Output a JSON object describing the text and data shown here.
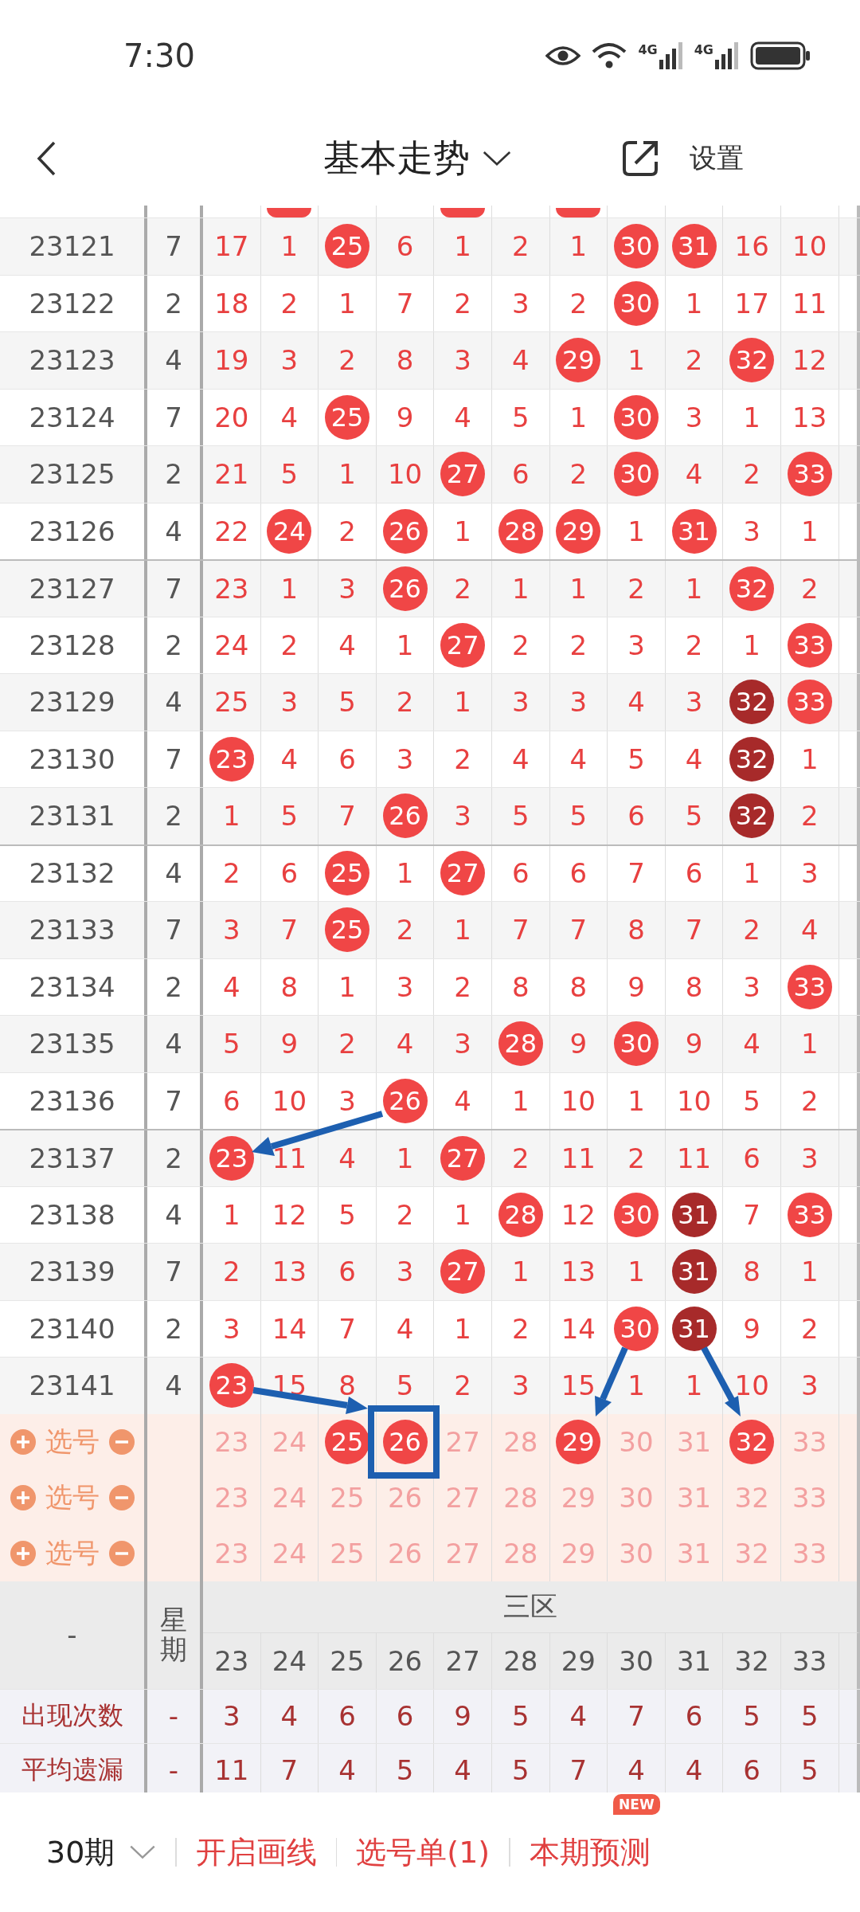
{
  "status_bar": {
    "time": "7:30",
    "network_labels": [
      "4G",
      "4G"
    ]
  },
  "header": {
    "title": "基本走势",
    "settings": "设置"
  },
  "cut_off_row": {
    "hits": [
      false,
      true,
      false,
      false,
      true,
      false,
      true,
      false,
      false,
      false,
      false
    ]
  },
  "rows": [
    {
      "period": "23121",
      "weekday": "7",
      "cells": [
        {
          "value": "17",
          "hit": false
        },
        {
          "value": "1",
          "hit": false
        },
        {
          "value": "25",
          "hit": true
        },
        {
          "value": "6",
          "hit": false
        },
        {
          "value": "1",
          "hit": false
        },
        {
          "value": "2",
          "hit": false
        },
        {
          "value": "1",
          "hit": false
        },
        {
          "value": "30",
          "hit": true
        },
        {
          "value": "31",
          "hit": true
        },
        {
          "value": "16",
          "hit": false
        },
        {
          "value": "10",
          "hit": false
        }
      ]
    },
    {
      "period": "23122",
      "weekday": "2",
      "cells": [
        {
          "value": "18",
          "hit": false
        },
        {
          "value": "2",
          "hit": false
        },
        {
          "value": "1",
          "hit": false
        },
        {
          "value": "7",
          "hit": false
        },
        {
          "value": "2",
          "hit": false
        },
        {
          "value": "3",
          "hit": false
        },
        {
          "value": "2",
          "hit": false
        },
        {
          "value": "30",
          "hit": true
        },
        {
          "value": "1",
          "hit": false
        },
        {
          "value": "17",
          "hit": false
        },
        {
          "value": "11",
          "hit": false
        }
      ]
    },
    {
      "period": "23123",
      "weekday": "4",
      "cells": [
        {
          "value": "19",
          "hit": false
        },
        {
          "value": "3",
          "hit": false
        },
        {
          "value": "2",
          "hit": false
        },
        {
          "value": "8",
          "hit": false
        },
        {
          "value": "3",
          "hit": false
        },
        {
          "value": "4",
          "hit": false
        },
        {
          "value": "29",
          "hit": true
        },
        {
          "value": "1",
          "hit": false
        },
        {
          "value": "2",
          "hit": false
        },
        {
          "value": "32",
          "hit": true
        },
        {
          "value": "12",
          "hit": false
        }
      ]
    },
    {
      "period": "23124",
      "weekday": "7",
      "cells": [
        {
          "value": "20",
          "hit": false
        },
        {
          "value": "4",
          "hit": false
        },
        {
          "value": "25",
          "hit": true
        },
        {
          "value": "9",
          "hit": false
        },
        {
          "value": "4",
          "hit": false
        },
        {
          "value": "5",
          "hit": false
        },
        {
          "value": "1",
          "hit": false
        },
        {
          "value": "30",
          "hit": true
        },
        {
          "value": "3",
          "hit": false
        },
        {
          "value": "1",
          "hit": false
        },
        {
          "value": "13",
          "hit": false
        }
      ]
    },
    {
      "period": "23125",
      "weekday": "2",
      "cells": [
        {
          "value": "21",
          "hit": false
        },
        {
          "value": "5",
          "hit": false
        },
        {
          "value": "1",
          "hit": false
        },
        {
          "value": "10",
          "hit": false
        },
        {
          "value": "27",
          "hit": true
        },
        {
          "value": "6",
          "hit": false
        },
        {
          "value": "2",
          "hit": false
        },
        {
          "value": "30",
          "hit": true
        },
        {
          "value": "4",
          "hit": false
        },
        {
          "value": "2",
          "hit": false
        },
        {
          "value": "33",
          "hit": true
        }
      ]
    },
    {
      "period": "23126",
      "weekday": "4",
      "cells": [
        {
          "value": "22",
          "hit": false
        },
        {
          "value": "24",
          "hit": true
        },
        {
          "value": "2",
          "hit": false
        },
        {
          "value": "26",
          "hit": true
        },
        {
          "value": "1",
          "hit": false
        },
        {
          "value": "28",
          "hit": true
        },
        {
          "value": "29",
          "hit": true
        },
        {
          "value": "1",
          "hit": false
        },
        {
          "value": "31",
          "hit": true
        },
        {
          "value": "3",
          "hit": false
        },
        {
          "value": "1",
          "hit": false
        }
      ]
    },
    {
      "period": "23127",
      "weekday": "7",
      "cells": [
        {
          "value": "23",
          "hit": false
        },
        {
          "value": "1",
          "hit": false
        },
        {
          "value": "3",
          "hit": false
        },
        {
          "value": "26",
          "hit": true
        },
        {
          "value": "2",
          "hit": false
        },
        {
          "value": "1",
          "hit": false
        },
        {
          "value": "1",
          "hit": false
        },
        {
          "value": "2",
          "hit": false
        },
        {
          "value": "1",
          "hit": false
        },
        {
          "value": "32",
          "hit": true
        },
        {
          "value": "2",
          "hit": false
        }
      ]
    },
    {
      "period": "23128",
      "weekday": "2",
      "cells": [
        {
          "value": "24",
          "hit": false
        },
        {
          "value": "2",
          "hit": false
        },
        {
          "value": "4",
          "hit": false
        },
        {
          "value": "1",
          "hit": false
        },
        {
          "value": "27",
          "hit": true
        },
        {
          "value": "2",
          "hit": false
        },
        {
          "value": "2",
          "hit": false
        },
        {
          "value": "3",
          "hit": false
        },
        {
          "value": "2",
          "hit": false
        },
        {
          "value": "1",
          "hit": false
        },
        {
          "value": "33",
          "hit": true
        }
      ]
    },
    {
      "period": "23129",
      "weekday": "4",
      "cells": [
        {
          "value": "25",
          "hit": false
        },
        {
          "value": "3",
          "hit": false
        },
        {
          "value": "5",
          "hit": false
        },
        {
          "value": "2",
          "hit": false
        },
        {
          "value": "1",
          "hit": false
        },
        {
          "value": "3",
          "hit": false
        },
        {
          "value": "3",
          "hit": false
        },
        {
          "value": "4",
          "hit": false
        },
        {
          "value": "3",
          "hit": false
        },
        {
          "value": "32",
          "hit": true,
          "streak": true
        },
        {
          "value": "33",
          "hit": true
        }
      ]
    },
    {
      "period": "23130",
      "weekday": "7",
      "cells": [
        {
          "value": "23",
          "hit": true
        },
        {
          "value": "4",
          "hit": false
        },
        {
          "value": "6",
          "hit": false
        },
        {
          "value": "3",
          "hit": false
        },
        {
          "value": "2",
          "hit": false
        },
        {
          "value": "4",
          "hit": false
        },
        {
          "value": "4",
          "hit": false
        },
        {
          "value": "5",
          "hit": false
        },
        {
          "value": "4",
          "hit": false
        },
        {
          "value": "32",
          "hit": true,
          "streak": true
        },
        {
          "value": "1",
          "hit": false
        }
      ]
    },
    {
      "period": "23131",
      "weekday": "2",
      "cells": [
        {
          "value": "1",
          "hit": false
        },
        {
          "value": "5",
          "hit": false
        },
        {
          "value": "7",
          "hit": false
        },
        {
          "value": "26",
          "hit": true
        },
        {
          "value": "3",
          "hit": false
        },
        {
          "value": "5",
          "hit": false
        },
        {
          "value": "5",
          "hit": false
        },
        {
          "value": "6",
          "hit": false
        },
        {
          "value": "5",
          "hit": false
        },
        {
          "value": "32",
          "hit": true,
          "streak": true
        },
        {
          "value": "2",
          "hit": false
        }
      ]
    },
    {
      "period": "23132",
      "weekday": "4",
      "cells": [
        {
          "value": "2",
          "hit": false
        },
        {
          "value": "6",
          "hit": false
        },
        {
          "value": "25",
          "hit": true
        },
        {
          "value": "1",
          "hit": false
        },
        {
          "value": "27",
          "hit": true
        },
        {
          "value": "6",
          "hit": false
        },
        {
          "value": "6",
          "hit": false
        },
        {
          "value": "7",
          "hit": false
        },
        {
          "value": "6",
          "hit": false
        },
        {
          "value": "1",
          "hit": false
        },
        {
          "value": "3",
          "hit": false
        }
      ]
    },
    {
      "period": "23133",
      "weekday": "7",
      "cells": [
        {
          "value": "3",
          "hit": false
        },
        {
          "value": "7",
          "hit": false
        },
        {
          "value": "25",
          "hit": true
        },
        {
          "value": "2",
          "hit": false
        },
        {
          "value": "1",
          "hit": false
        },
        {
          "value": "7",
          "hit": false
        },
        {
          "value": "7",
          "hit": false
        },
        {
          "value": "8",
          "hit": false
        },
        {
          "value": "7",
          "hit": false
        },
        {
          "value": "2",
          "hit": false
        },
        {
          "value": "4",
          "hit": false
        }
      ]
    },
    {
      "period": "23134",
      "weekday": "2",
      "cells": [
        {
          "value": "4",
          "hit": false
        },
        {
          "value": "8",
          "hit": false
        },
        {
          "value": "1",
          "hit": false
        },
        {
          "value": "3",
          "hit": false
        },
        {
          "value": "2",
          "hit": false
        },
        {
          "value": "8",
          "hit": false
        },
        {
          "value": "8",
          "hit": false
        },
        {
          "value": "9",
          "hit": false
        },
        {
          "value": "8",
          "hit": false
        },
        {
          "value": "3",
          "hit": false
        },
        {
          "value": "33",
          "hit": true
        }
      ]
    },
    {
      "period": "23135",
      "weekday": "4",
      "cells": [
        {
          "value": "5",
          "hit": false
        },
        {
          "value": "9",
          "hit": false
        },
        {
          "value": "2",
          "hit": false
        },
        {
          "value": "4",
          "hit": false
        },
        {
          "value": "3",
          "hit": false
        },
        {
          "value": "28",
          "hit": true
        },
        {
          "value": "9",
          "hit": false
        },
        {
          "value": "30",
          "hit": true
        },
        {
          "value": "9",
          "hit": false
        },
        {
          "value": "4",
          "hit": false
        },
        {
          "value": "1",
          "hit": false
        }
      ]
    },
    {
      "period": "23136",
      "weekday": "7",
      "cells": [
        {
          "value": "6",
          "hit": false
        },
        {
          "value": "10",
          "hit": false
        },
        {
          "value": "3",
          "hit": false
        },
        {
          "value": "26",
          "hit": true
        },
        {
          "value": "4",
          "hit": false
        },
        {
          "value": "1",
          "hit": false
        },
        {
          "value": "10",
          "hit": false
        },
        {
          "value": "1",
          "hit": false
        },
        {
          "value": "10",
          "hit": false
        },
        {
          "value": "5",
          "hit": false
        },
        {
          "value": "2",
          "hit": false
        }
      ]
    },
    {
      "period": "23137",
      "weekday": "2",
      "cells": [
        {
          "value": "23",
          "hit": true
        },
        {
          "value": "11",
          "hit": false
        },
        {
          "value": "4",
          "hit": false
        },
        {
          "value": "1",
          "hit": false
        },
        {
          "value": "27",
          "hit": true
        },
        {
          "value": "2",
          "hit": false
        },
        {
          "value": "11",
          "hit": false
        },
        {
          "value": "2",
          "hit": false
        },
        {
          "value": "11",
          "hit": false
        },
        {
          "value": "6",
          "hit": false
        },
        {
          "value": "3",
          "hit": false
        }
      ]
    },
    {
      "period": "23138",
      "weekday": "4",
      "cells": [
        {
          "value": "1",
          "hit": false
        },
        {
          "value": "12",
          "hit": false
        },
        {
          "value": "5",
          "hit": false
        },
        {
          "value": "2",
          "hit": false
        },
        {
          "value": "1",
          "hit": false
        },
        {
          "value": "28",
          "hit": true
        },
        {
          "value": "12",
          "hit": false
        },
        {
          "value": "30",
          "hit": true
        },
        {
          "value": "31",
          "hit": true,
          "streak": true
        },
        {
          "value": "7",
          "hit": false
        },
        {
          "value": "33",
          "hit": true
        }
      ]
    },
    {
      "period": "23139",
      "weekday": "7",
      "cells": [
        {
          "value": "2",
          "hit": false
        },
        {
          "value": "13",
          "hit": false
        },
        {
          "value": "6",
          "hit": false
        },
        {
          "value": "3",
          "hit": false
        },
        {
          "value": "27",
          "hit": true
        },
        {
          "value": "1",
          "hit": false
        },
        {
          "value": "13",
          "hit": false
        },
        {
          "value": "1",
          "hit": false
        },
        {
          "value": "31",
          "hit": true,
          "streak": true
        },
        {
          "value": "8",
          "hit": false
        },
        {
          "value": "1",
          "hit": false
        }
      ]
    },
    {
      "period": "23140",
      "weekday": "2",
      "cells": [
        {
          "value": "3",
          "hit": false
        },
        {
          "value": "14",
          "hit": false
        },
        {
          "value": "7",
          "hit": false
        },
        {
          "value": "4",
          "hit": false
        },
        {
          "value": "1",
          "hit": false
        },
        {
          "value": "2",
          "hit": false
        },
        {
          "value": "14",
          "hit": false
        },
        {
          "value": "30",
          "hit": true
        },
        {
          "value": "31",
          "hit": true,
          "streak": true
        },
        {
          "value": "9",
          "hit": false
        },
        {
          "value": "2",
          "hit": false
        }
      ]
    },
    {
      "period": "23141",
      "weekday": "4",
      "cells": [
        {
          "value": "23",
          "hit": true
        },
        {
          "value": "15",
          "hit": false
        },
        {
          "value": "8",
          "hit": false
        },
        {
          "value": "5",
          "hit": false
        },
        {
          "value": "2",
          "hit": false
        },
        {
          "value": "3",
          "hit": false
        },
        {
          "value": "15",
          "hit": false
        },
        {
          "value": "1",
          "hit": false
        },
        {
          "value": "1",
          "hit": false
        },
        {
          "value": "10",
          "hit": false
        },
        {
          "value": "3",
          "hit": false
        }
      ]
    }
  ],
  "picks": [
    {
      "label": "选号",
      "numbers": [
        {
          "n": "23",
          "selected": false
        },
        {
          "n": "24",
          "selected": false
        },
        {
          "n": "25",
          "selected": true
        },
        {
          "n": "26",
          "selected": true
        },
        {
          "n": "27",
          "selected": false
        },
        {
          "n": "28",
          "selected": false
        },
        {
          "n": "29",
          "selected": true
        },
        {
          "n": "30",
          "selected": false
        },
        {
          "n": "31",
          "selected": false
        },
        {
          "n": "32",
          "selected": true
        },
        {
          "n": "33",
          "selected": false
        }
      ]
    },
    {
      "label": "选号",
      "numbers": [
        {
          "n": "23",
          "selected": false
        },
        {
          "n": "24",
          "selected": false
        },
        {
          "n": "25",
          "selected": false
        },
        {
          "n": "26",
          "selected": false
        },
        {
          "n": "27",
          "selected": false
        },
        {
          "n": "28",
          "selected": false
        },
        {
          "n": "29",
          "selected": false
        },
        {
          "n": "30",
          "selected": false
        },
        {
          "n": "31",
          "selected": false
        },
        {
          "n": "32",
          "selected": false
        },
        {
          "n": "33",
          "selected": false
        }
      ]
    },
    {
      "label": "选号",
      "numbers": [
        {
          "n": "23",
          "selected": false
        },
        {
          "n": "24",
          "selected": false
        },
        {
          "n": "25",
          "selected": false
        },
        {
          "n": "26",
          "selected": false
        },
        {
          "n": "27",
          "selected": false
        },
        {
          "n": "28",
          "selected": false
        },
        {
          "n": "29",
          "selected": false
        },
        {
          "n": "30",
          "selected": false
        },
        {
          "n": "31",
          "selected": false
        },
        {
          "n": "32",
          "selected": false
        },
        {
          "n": "33",
          "selected": false
        }
      ]
    }
  ],
  "summary": {
    "corner": "-",
    "weekday_header": "星期",
    "zone": "三区",
    "numbers": [
      "23",
      "24",
      "25",
      "26",
      "27",
      "28",
      "29",
      "30",
      "31",
      "32",
      "33"
    ],
    "stats": [
      {
        "label": "出现次数",
        "weekday": "-",
        "values": [
          "3",
          "4",
          "6",
          "6",
          "9",
          "5",
          "4",
          "7",
          "6",
          "5",
          "5"
        ]
      },
      {
        "label": "平均遗漏",
        "weekday": "-",
        "values": [
          "11",
          "7",
          "4",
          "5",
          "4",
          "5",
          "7",
          "4",
          "4",
          "6",
          "5"
        ]
      }
    ]
  },
  "bottom_bar": {
    "period_select": "30期",
    "actions": [
      "开启画线",
      "选号单(1)",
      "本期预测"
    ],
    "badge": "NEW"
  }
}
